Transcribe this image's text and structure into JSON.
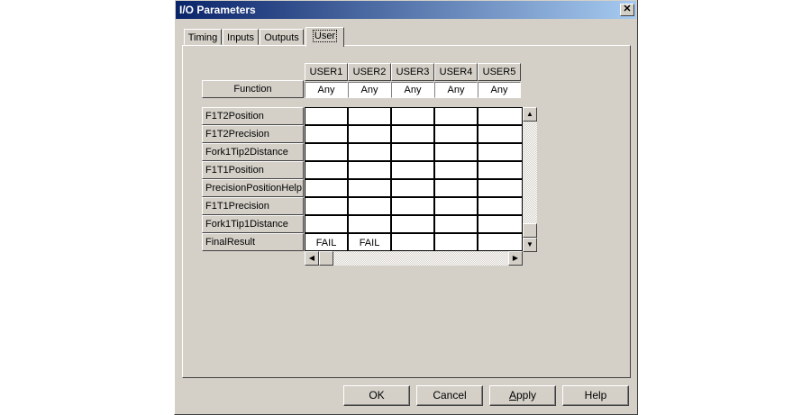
{
  "window": {
    "title": "I/O Parameters",
    "close_glyph": "✕"
  },
  "tabs": [
    {
      "label": "Timing"
    },
    {
      "label": "Inputs"
    },
    {
      "label": "Outputs"
    },
    {
      "label": "User",
      "active": true
    }
  ],
  "grid": {
    "columns": [
      "USER1",
      "USER2",
      "USER3",
      "USER4",
      "USER5"
    ],
    "function_label": "Function",
    "function_values": [
      "Any",
      "Any",
      "Any",
      "Any",
      "Any"
    ],
    "rows": [
      {
        "label": "F1T2Position",
        "values": [
          "",
          "",
          "",
          "",
          ""
        ]
      },
      {
        "label": "F1T2Precision",
        "values": [
          "",
          "",
          "",
          "",
          ""
        ]
      },
      {
        "label": "Fork1Tip2Distance",
        "values": [
          "",
          "",
          "",
          "",
          ""
        ]
      },
      {
        "label": "F1T1Position",
        "values": [
          "",
          "",
          "",
          "",
          ""
        ]
      },
      {
        "label": "PrecisionPositionHelp",
        "values": [
          "",
          "",
          "",
          "",
          ""
        ]
      },
      {
        "label": "F1T1Precision",
        "values": [
          "",
          "",
          "",
          "",
          ""
        ]
      },
      {
        "label": "Fork1Tip1Distance",
        "values": [
          "",
          "",
          "",
          "",
          ""
        ]
      },
      {
        "label": "FinalResult",
        "values": [
          "FAIL",
          "FAIL",
          "",
          "",
          ""
        ]
      }
    ]
  },
  "scrollbar_icons": {
    "up": "▲",
    "down": "▼",
    "left": "◀",
    "right": "▶"
  },
  "buttons": {
    "ok": "OK",
    "cancel": "Cancel",
    "apply_prefix": "",
    "apply_underlined": "A",
    "apply_rest": "pply",
    "help": "Help"
  },
  "colors": {
    "face": "#d4d0c8",
    "titlebar_start": "#0a246a",
    "titlebar_end": "#a6caf0"
  }
}
